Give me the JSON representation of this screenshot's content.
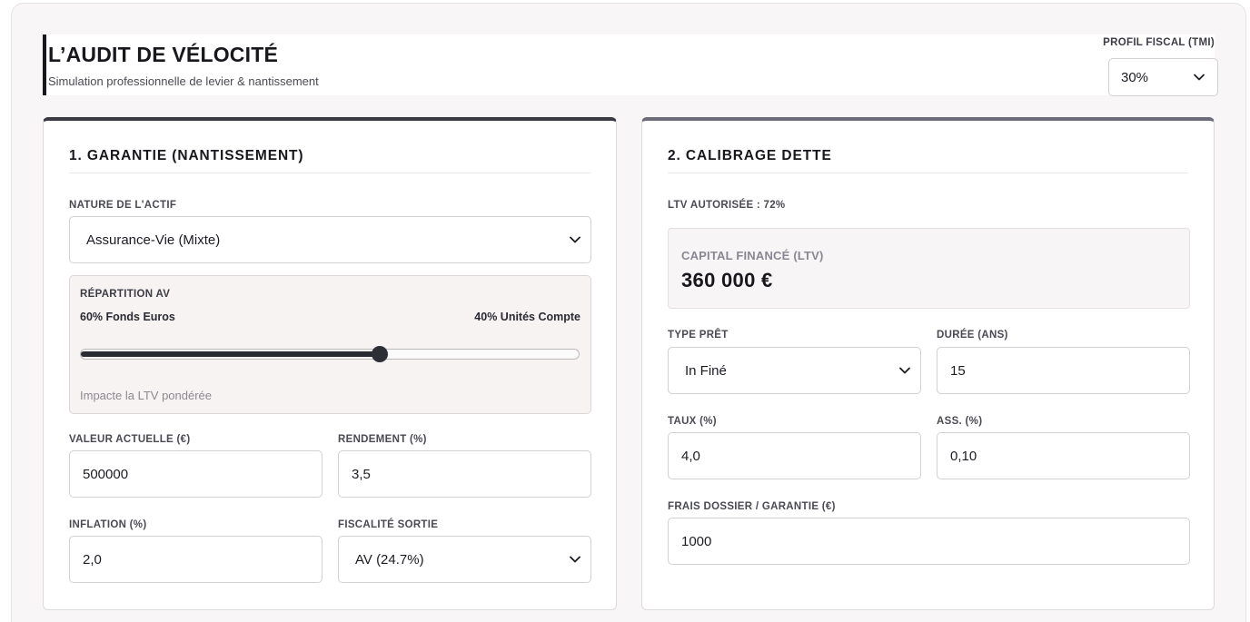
{
  "header": {
    "title": "L’AUDIT DE VÉLOCITÉ",
    "subtitle": "Simulation professionnelle de levier & nantissement",
    "fiscal_label": "PROFIL FISCAL (TMI)",
    "fiscal_value": "30%"
  },
  "garantie": {
    "title": "1. GARANTIE (NANTISSEMENT)",
    "nature_label": "NATURE DE L'ACTIF",
    "nature_value": "Assurance-Vie (Mixte)",
    "repartition": {
      "title": "RÉPARTITION AV",
      "left_text": "60% Fonds Euros",
      "right_text": "40% Unités Compte",
      "slider_fraction": 0.6,
      "note": "Impacte la LTV pondérée"
    },
    "valeur_label": "VALEUR ACTUELLE (€)",
    "valeur_value": "500000",
    "rendement_label": "RENDEMENT (%)",
    "rendement_value": "3,5",
    "inflation_label": "INFLATION (%)",
    "inflation_value": "2,0",
    "fiscalite_label": "FISCALITÉ SORTIE",
    "fiscalite_value": "AV (24.7%)"
  },
  "dette": {
    "title": "2. CALIBRAGE DETTE",
    "ltv_autorisee": "LTV AUTORISÉE : 72%",
    "capital_label": "CAPITAL FINANCÉ (LTV)",
    "capital_value": "360 000 €",
    "type_label": "TYPE PRÊT",
    "type_value": "In Finé",
    "duree_label": "DURÉE (ANS)",
    "duree_value": "15",
    "taux_label": "TAUX (%)",
    "taux_value": "4,0",
    "ass_label": "ASS. (%)",
    "ass_value": "0,10",
    "frais_label": "FRAIS DOSSIER / GARANTIE (€)",
    "frais_value": "1000"
  },
  "icons": {
    "chevron": "chevron-down-icon"
  }
}
